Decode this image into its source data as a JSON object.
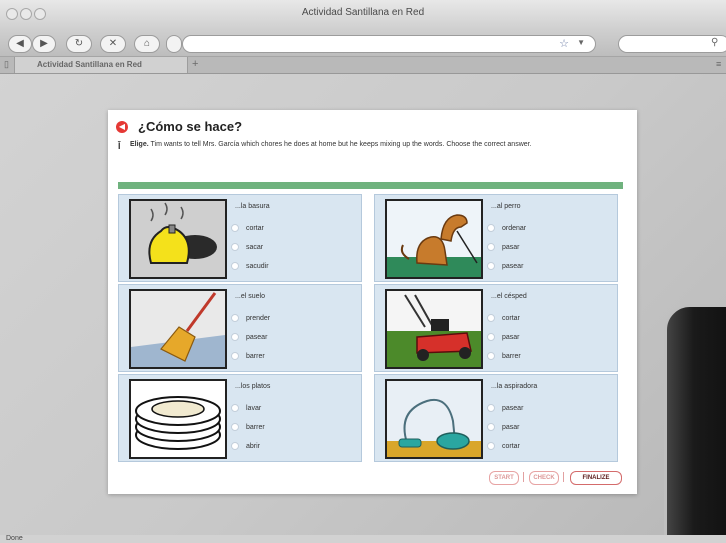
{
  "window": {
    "title": "Actividad Santillana en Red"
  },
  "tabs": [
    {
      "label": "Actividad Santillana en Red"
    }
  ],
  "toolbar": {
    "new_tab": "+"
  },
  "status": {
    "text": "Done"
  },
  "activity": {
    "heading": "¿Cómo se hace?",
    "instruction_bold": "Elige.",
    "instruction": " Tim wants to tell Mrs. García which chores he does at home but he keeps mixing up the words. Choose the correct answer.",
    "items": [
      {
        "prompt": "...la basura",
        "options": [
          "cortar",
          "sacar",
          "sacudir"
        ]
      },
      {
        "prompt": "...al perro",
        "options": [
          "ordenar",
          "pasar",
          "pasear"
        ]
      },
      {
        "prompt": "...el suelo",
        "options": [
          "prender",
          "pasear",
          "barrer"
        ]
      },
      {
        "prompt": "...el césped",
        "options": [
          "cortar",
          "pasar",
          "barrer"
        ]
      },
      {
        "prompt": "...los platos",
        "options": [
          "lavar",
          "barrer",
          "abrir"
        ]
      },
      {
        "prompt": "...la aspiradora",
        "options": [
          "pasear",
          "pasar",
          "cortar"
        ]
      }
    ],
    "buttons": {
      "start": "START",
      "check": "CHECK",
      "finalize": "FINALIZE"
    }
  }
}
